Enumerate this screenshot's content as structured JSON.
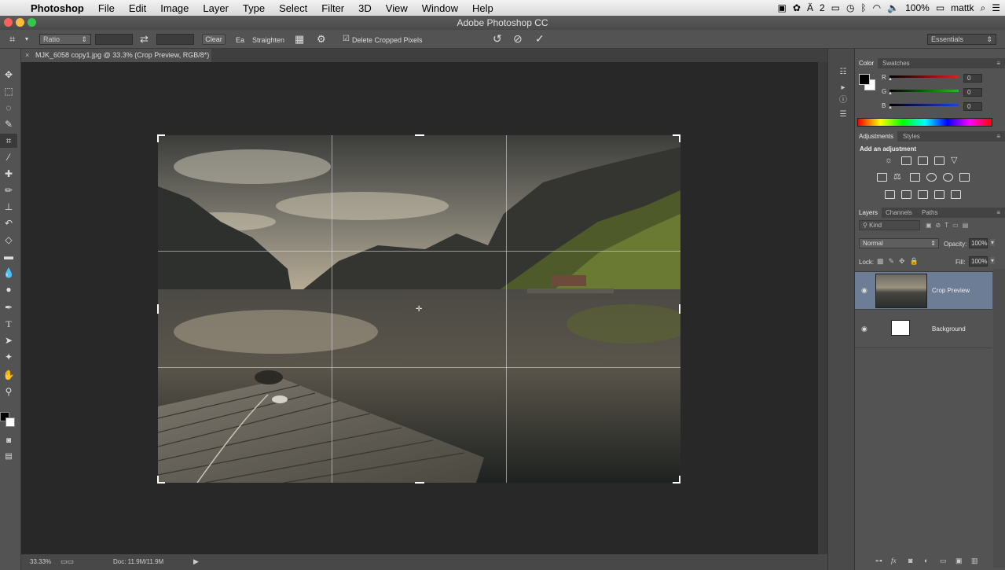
{
  "menubar": {
    "apple": "",
    "items": [
      "Photoshop",
      "File",
      "Edit",
      "Image",
      "Layer",
      "Type",
      "Select",
      "Filter",
      "3D",
      "View",
      "Window",
      "Help"
    ],
    "status": {
      "wifi_icon": "wifi-icon",
      "volume": "🔈",
      "battery": "100%",
      "user": "mattk",
      "search": "⌕",
      "menu": "☰",
      "adobe_badge": "2"
    }
  },
  "window": {
    "title": "Adobe Photoshop CC",
    "light_colors": [
      "#fc605c",
      "#fdbc40",
      "#34c84a"
    ]
  },
  "options": {
    "ratio": "Ratio",
    "clear": "Clear",
    "straighten_prefix": "Ea",
    "straighten": "Straighten",
    "delete_cropped": "Delete Cropped Pixels",
    "workspace": "Essentials"
  },
  "doc": {
    "tab": "MJK_6058 copy1.jpg @ 33.3% (Crop Preview, RGB/8*)",
    "close": "×"
  },
  "status": {
    "zoom": "33.33%",
    "doc": "Doc: 11.9M/11.9M"
  },
  "tools": [
    "move-tool",
    "marquee-tool",
    "lasso-tool",
    "quick-select-tool",
    "crop-tool",
    "eyedropper-tool",
    "healing-tool",
    "brush-tool",
    "stamp-tool",
    "history-brush-tool",
    "eraser-tool",
    "gradient-tool",
    "blur-tool",
    "dodge-tool",
    "pen-tool",
    "type-tool",
    "path-select-tool",
    "shape-tool",
    "hand-tool",
    "zoom-tool"
  ],
  "color_panel": {
    "tabs": [
      "Color",
      "Swatches"
    ],
    "channels": [
      {
        "label": "R",
        "value": "0",
        "color": "#e02020"
      },
      {
        "label": "G",
        "value": "0",
        "color": "#20c020"
      },
      {
        "label": "B",
        "value": "0",
        "color": "#2040e0"
      }
    ]
  },
  "adjust_panel": {
    "tabs": [
      "Adjustments",
      "Styles"
    ],
    "heading": "Add an adjustment"
  },
  "layers_panel": {
    "tabs": [
      "Layers",
      "Channels",
      "Paths"
    ],
    "filter": "Kind",
    "blend": "Normal",
    "opacity_label": "Opacity:",
    "opacity": "100%",
    "lock_label": "Lock:",
    "fill_label": "Fill:",
    "fill": "100%",
    "layers": [
      {
        "name": "Crop Preview",
        "selected": true
      },
      {
        "name": "Background",
        "selected": false
      }
    ]
  },
  "accent": "#6d7d96"
}
